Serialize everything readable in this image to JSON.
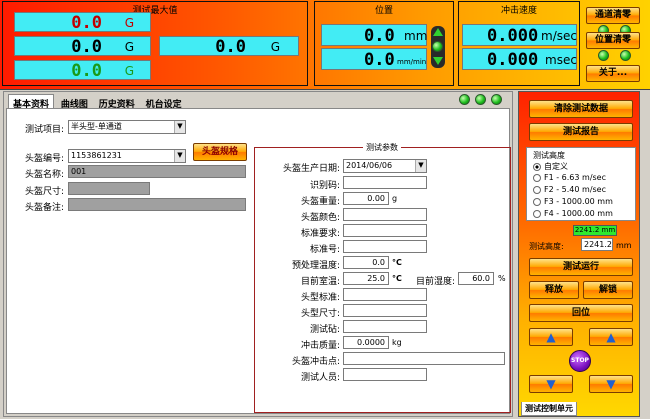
{
  "max": {
    "title": "测试最大值",
    "v1": "0.0",
    "u1": "G",
    "v2": "0.0",
    "u2": "G",
    "v3": "0.0",
    "u3": "G",
    "v4": "0.0",
    "u4": "G"
  },
  "pos": {
    "title": "位置",
    "v1": "0.0",
    "u1": "mm",
    "v2": "0.0",
    "u2": "mm/min"
  },
  "speed": {
    "title": "冲击速度",
    "v1": "0.000",
    "u1": "m/sec",
    "v2": "0.000",
    "u2": "msec"
  },
  "top_buttons": {
    "ch_zero": "通道清零",
    "pos_zero": "位置清零",
    "close": "关于..."
  },
  "tabs": [
    "基本资料",
    "曲线图",
    "历史资料",
    "机台设定"
  ],
  "basic": {
    "item_label": "测试项目:",
    "item_value": "半头型-单通道",
    "code_label": "头盔编号:",
    "code_value": "1153861231",
    "spec_button": "头盔规格",
    "name_label": "头盔名称:",
    "name_value": "001",
    "size_label": "头盔尺寸:",
    "note_label": "头盔备注:"
  },
  "params": {
    "title": "测试参数",
    "date_label": "头盔生产日期:",
    "date_value": "2014/06/06",
    "idcode_label": "识别码:",
    "weight_label": "头盔重量:",
    "weight_value": "0.00",
    "weight_unit": "g",
    "color_label": "头盔颜色:",
    "standard_label": "标准要求:",
    "stdno_label": "标准号:",
    "pretemp_label": "预处理温度:",
    "pretemp_value": "0.0",
    "pretemp_unit": "°C",
    "roomtemp_label": "目前室温:",
    "roomtemp_value": "25.0",
    "roomtemp_unit": "°C",
    "humidity_label": "目前湿度:",
    "humidity_value": "60.0",
    "humidity_unit": "%",
    "headform_label": "头型标准:",
    "headsize_label": "头型尺寸:",
    "anvil_label": "测试砧:",
    "mass_label": "冲击质量:",
    "mass_value": "0.0000",
    "mass_unit": "kg",
    "point_label": "头盔冲击点:",
    "person_label": "测试人员:"
  },
  "control": {
    "clear_data": "清除测试数据",
    "report": "测试报告",
    "height_group": "测试高度",
    "options": [
      "自定义",
      "F1 - 6.63 m/sec",
      "F2 - 5.40 m/sec",
      "F3 - 1000.00 mm",
      "F4 - 1000.00 mm"
    ],
    "selected": "自定义",
    "green_display": "2241.2 mm",
    "height_label": "测试高度:",
    "height_value": "2241.2",
    "height_unit": "mm",
    "run": "测试运行",
    "release": "释放",
    "lock": "解锁",
    "reset": "回位",
    "stop": "STOP",
    "unit_tab": "测试控制单元"
  },
  "colors": {
    "cyan": "#42ecf4",
    "red": "#c00000",
    "accent": "#ff8c00"
  }
}
